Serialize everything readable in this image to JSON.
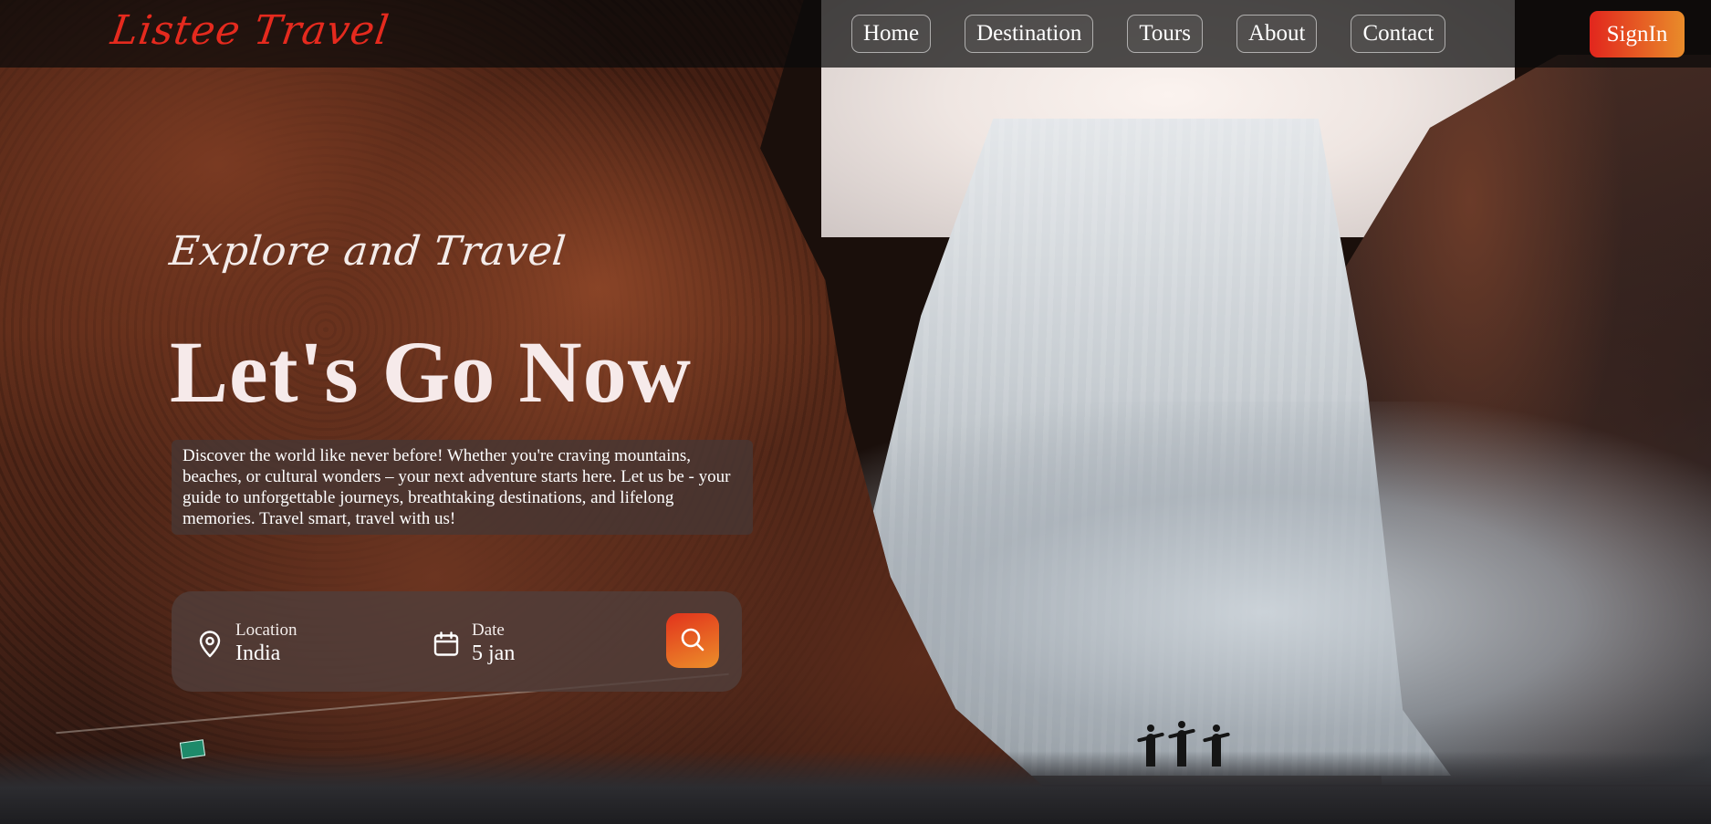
{
  "brand": {
    "logo_text": "Listee Travel"
  },
  "nav": {
    "items": [
      {
        "label": "Home"
      },
      {
        "label": "Destination"
      },
      {
        "label": "Tours"
      },
      {
        "label": "About"
      },
      {
        "label": "Contact"
      }
    ],
    "signin_label": "SignIn"
  },
  "hero": {
    "tagline": "Explore and Travel",
    "headline": "Let's Go Now",
    "description": "Discover the world like never before! Whether you're craving mountains, beaches, or cultural wonders – your next adventure starts here. Let us be - your guide to unforgettable journeys, breathtaking destinations, and lifelong memories. Travel smart, travel with us!"
  },
  "search": {
    "location": {
      "label": "Location",
      "value": "India",
      "icon": "location-pin-icon"
    },
    "date": {
      "label": "Date",
      "value": "5 jan",
      "icon": "calendar-icon"
    },
    "button_icon": "search-icon"
  },
  "colors": {
    "brand_red": "#e52a1e",
    "accent_gradient_start": "#e2261d",
    "accent_gradient_end": "#e98c2a"
  }
}
